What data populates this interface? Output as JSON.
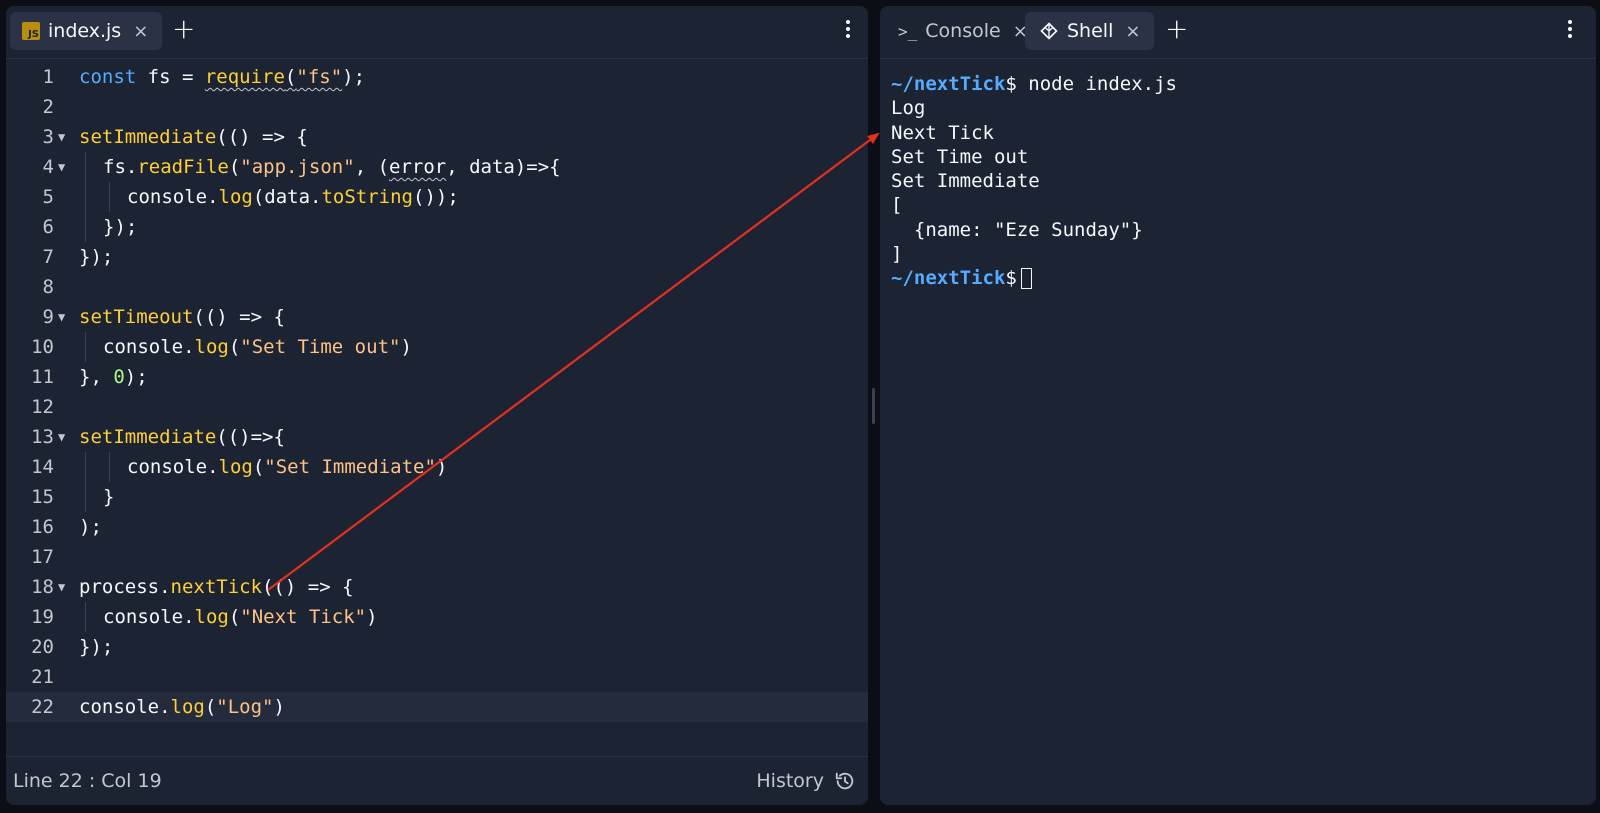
{
  "editor": {
    "tab_label": "index.js",
    "tab_icon": "js-file-icon",
    "js_badge": "JS",
    "close_glyph": "×",
    "new_tab_glyph": "+",
    "code_lines": [
      "1",
      "2",
      "3",
      "4",
      "5",
      "6",
      "7",
      "8",
      "9",
      "10",
      "11",
      "12",
      "13",
      "14",
      "15",
      "16",
      "17",
      "18",
      "19",
      "20",
      "21",
      "22"
    ],
    "code": {
      "l1": {
        "a": "const",
        "b": " fs = ",
        "c": "require",
        "d": "(",
        "e": "\"fs\"",
        "f": ");"
      },
      "l3": {
        "a": "setImmediate",
        "b": "(() => {"
      },
      "l4": {
        "a": "fs.",
        "b": "readFile",
        "c": "(",
        "d": "\"app.json\"",
        "e": ", (",
        "f": "error",
        "g": ", data)=>{"
      },
      "l5": {
        "a": "console.",
        "b": "log",
        "c": "(data.",
        "d": "toString",
        "e": "());"
      },
      "l6": {
        "a": "});"
      },
      "l7": {
        "a": "});"
      },
      "l9": {
        "a": "setTimeout",
        "b": "(() => {"
      },
      "l10": {
        "a": "console.",
        "b": "log",
        "c": "(",
        "d": "\"Set Time out\"",
        "e": ")"
      },
      "l11": {
        "a": "}, ",
        "b": "0",
        "c": ");"
      },
      "l13": {
        "a": "setImmediate",
        "b": "(()=>{"
      },
      "l14": {
        "a": "console.",
        "b": "log",
        "c": "(",
        "d": "\"Set Immediate\"",
        "e": ")"
      },
      "l15": {
        "a": "}"
      },
      "l16": {
        "a": ");"
      },
      "l18": {
        "a": "process.",
        "b": "nextTick",
        "c": "(() => {"
      },
      "l19": {
        "a": "console.",
        "b": "log",
        "c": "(",
        "d": "\"Next Tick\"",
        "e": ")"
      },
      "l20": {
        "a": "});"
      },
      "l22": {
        "a": "console.",
        "b": "log",
        "c": "(",
        "d": "\"Log\"",
        "e": ")"
      }
    },
    "status": {
      "position": "Line 22 : Col 19",
      "history_label": "History",
      "history_icon": "history-icon"
    }
  },
  "shell": {
    "tabs": [
      {
        "label": "Console",
        "icon": "terminal-prompt-icon",
        "glyph": ">_"
      },
      {
        "label": "Shell",
        "icon": "shell-icon"
      }
    ],
    "close_glyph": "×",
    "new_tab_glyph": "+",
    "prompt": "~/nextTick",
    "dollar": "$",
    "command": " node index.js",
    "output": [
      "Log",
      "Next Tick",
      "Set Time out",
      "Set Immediate",
      "[",
      "  {name: \"Eze Sunday\"}",
      "]"
    ]
  },
  "colors": {
    "background": "#0b0e14",
    "pane": "#1c2333",
    "keyword": "#57abff",
    "function": "#ffcf35",
    "string": "#fec287",
    "number": "#b6f582",
    "arrow": "#e5301f"
  }
}
